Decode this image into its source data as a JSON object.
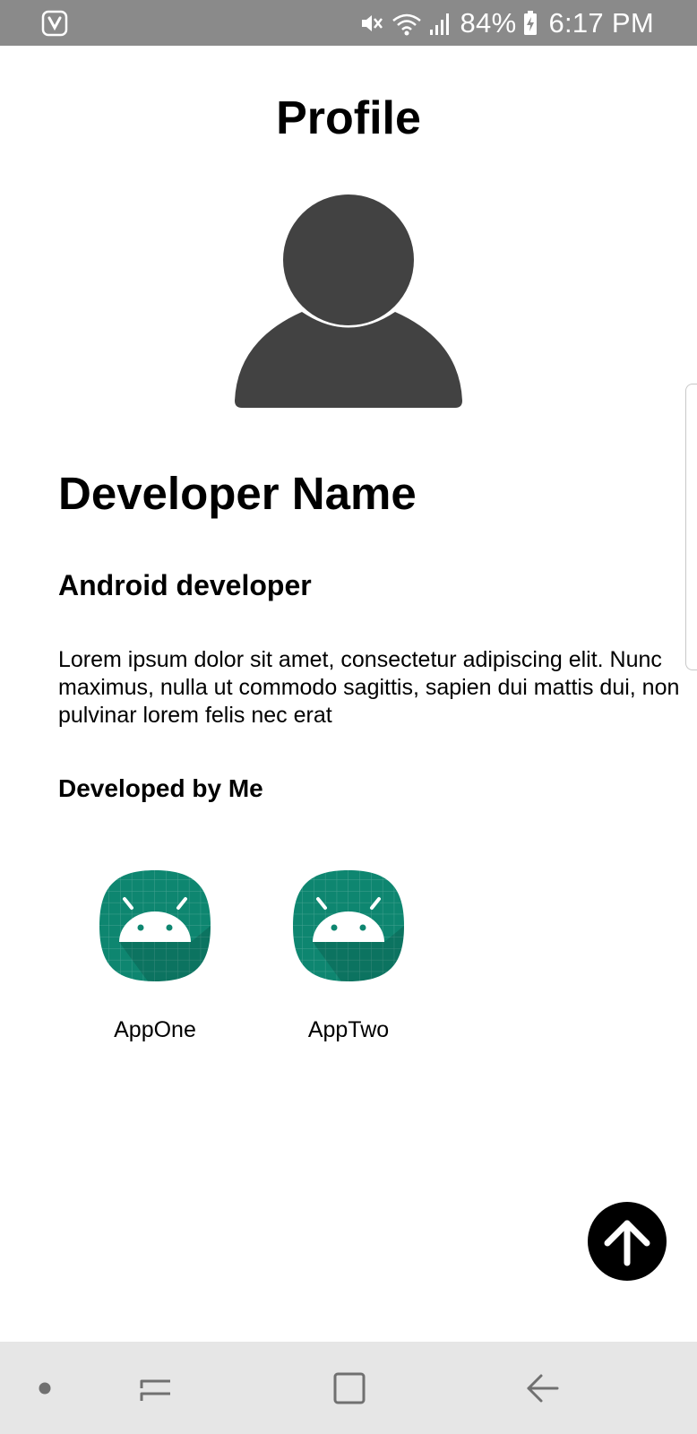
{
  "status_bar": {
    "battery_percent": "84%",
    "time": "6:17 PM",
    "icons": [
      "app-notification-icon",
      "mute-icon",
      "wifi-icon",
      "signal-icon",
      "battery-charging-icon"
    ]
  },
  "page": {
    "title": "Profile",
    "avatar_icon": "person-silhouette-icon",
    "developer_name": "Developer Name",
    "role": "Android developer",
    "bio": "Lorem ipsum dolor sit amet, consectetur adipiscing elit. Nunc maximus, nulla ut commodo sagittis, sapien dui mattis dui, non pulvinar lorem felis nec erat",
    "apps_heading": "Developed by Me",
    "apps": [
      {
        "label": "AppOne",
        "icon": "android-app-icon"
      },
      {
        "label": "AppTwo",
        "icon": "android-app-icon"
      }
    ]
  },
  "fab": {
    "icon": "arrow-up-icon"
  },
  "nav_bar": {
    "items": [
      "dot-icon",
      "recent-apps-icon",
      "home-icon",
      "back-icon"
    ]
  },
  "colors": {
    "status_bar": "#8a8a8a",
    "avatar": "#424242",
    "app_icon_bg": "#0e8670",
    "fab": "#000000",
    "nav_bar": "#e6e6e6"
  }
}
